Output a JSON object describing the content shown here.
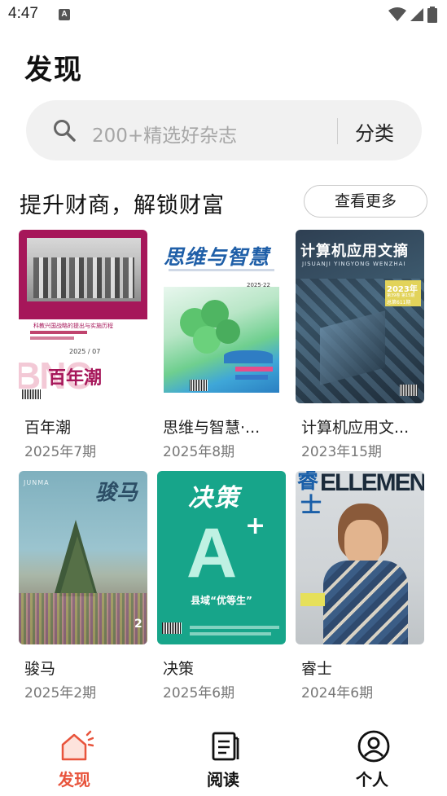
{
  "status": {
    "time": "4:47",
    "notif_icon": "A"
  },
  "page": {
    "title": "发现"
  },
  "search": {
    "placeholder": "200+精选好杂志",
    "category_label": "分类"
  },
  "section": {
    "title": "提升财商，解锁财富",
    "more_label": "查看更多"
  },
  "magazines": [
    {
      "name": "百年潮",
      "issue": "2025年7期",
      "cover_title": "百年潮",
      "cover_year": "2025 / 07",
      "cover_headline": "科教兴国战略的提出与实施历程",
      "cover_brand": "BNC"
    },
    {
      "name": "思维与智慧·...",
      "issue": "2025年8期",
      "cover_title": "思维与智慧",
      "cover_issue": "2025·22"
    },
    {
      "name": "计算机应用文...",
      "issue": "2023年15期",
      "cover_title": "计算机应用文摘",
      "cover_pinyin": "JISUANJI YINGYONG WENZHAI",
      "cover_badge_year": "2023年",
      "cover_badge_sub": "第39卷 第15期",
      "cover_badge_total": "总第611期"
    },
    {
      "name": "骏马",
      "issue": "2025年2期",
      "cover_title": "骏马",
      "cover_pinyin": "JUNMA",
      "cover_number": "2"
    },
    {
      "name": "决策",
      "issue": "2025年6期",
      "cover_title": "决策",
      "cover_big": "A",
      "cover_headline": "县域“优等生”"
    },
    {
      "name": "睿士",
      "issue": "2024年6期",
      "cover_title_top": "睿",
      "cover_title_bottom": "士",
      "cover_brand": "ELLEMEN"
    }
  ],
  "tabs": [
    {
      "label": "发现",
      "icon": "home-icon",
      "active": true,
      "color": "#e8543c"
    },
    {
      "label": "阅读",
      "icon": "book-icon",
      "active": false,
      "color": "#111111"
    },
    {
      "label": "个人",
      "icon": "person-icon",
      "active": false,
      "color": "#111111"
    }
  ]
}
